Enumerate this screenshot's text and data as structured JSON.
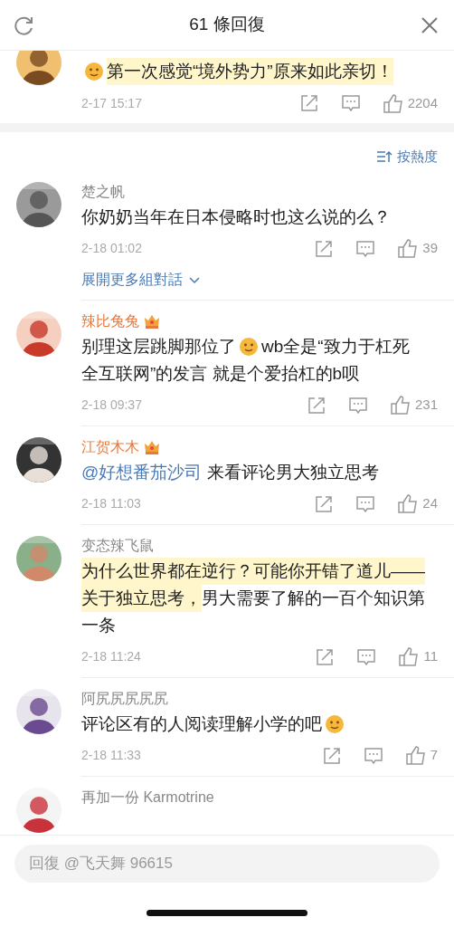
{
  "header": {
    "title": "61 條回復"
  },
  "top_comment": {
    "lines": [
      [
        {
          "kind": "emoji"
        },
        {
          "kind": "text",
          "text": "第一次感觉“境外势力”原来如此亲切！",
          "highlighted": true
        }
      ]
    ],
    "time": "2-17 15:17",
    "likes": "2204"
  },
  "sort": {
    "label": "按熱度"
  },
  "comments": [
    {
      "name": "楚之帆",
      "vip": false,
      "lines": [
        [
          {
            "kind": "text",
            "text": "你奶奶当年在日本侵略时也这么说的么？",
            "highlighted": false
          }
        ]
      ],
      "time": "2-18 01:02",
      "likes": "39",
      "expand": "展開更多組對話"
    },
    {
      "name": "辣比兔兔",
      "vip": true,
      "lines": [
        [
          {
            "kind": "text",
            "text": "别理这层跳脚那位了",
            "highlighted": false
          },
          {
            "kind": "emoji"
          },
          {
            "kind": "text",
            "text": "wb全是“致力于杠死",
            "highlighted": false
          }
        ],
        [
          {
            "kind": "text",
            "text": "全互联网”的发言 就是个爱抬杠的b呗",
            "highlighted": false
          }
        ]
      ],
      "time": "2-18 09:37",
      "likes": "231"
    },
    {
      "name": "江贺木木",
      "vip": true,
      "lines": [
        [
          {
            "kind": "mention",
            "text": "@好想番茄沙司"
          },
          {
            "kind": "text",
            "text": " 来看评论男大独立思考",
            "highlighted": false
          }
        ]
      ],
      "time": "2-18 11:03",
      "likes": "24"
    },
    {
      "name": "变态辣飞鼠",
      "vip": false,
      "lines": [
        [
          {
            "kind": "text",
            "text": "为什么世界都在逆行？可能你开错了道儿——",
            "highlighted": true
          }
        ],
        [
          {
            "kind": "text",
            "text": "关于独立思考，",
            "highlighted": true
          },
          {
            "kind": "text",
            "text": "男大需要了解的一百个知识第",
            "highlighted": false
          }
        ],
        [
          {
            "kind": "text",
            "text": "一条",
            "highlighted": false
          }
        ]
      ],
      "time": "2-18 11:24",
      "likes": "11"
    },
    {
      "name": "阿尻尻尻尻尻",
      "vip": false,
      "lines": [
        [
          {
            "kind": "text",
            "text": "评论区有的人阅读理解小学的吧",
            "highlighted": false
          },
          {
            "kind": "emoji"
          }
        ]
      ],
      "time": "2-18 11:33",
      "likes": "7"
    },
    {
      "name": "再加一份 Karmotrine",
      "vip": false
    }
  ],
  "reply_field": {
    "placeholder": "回復 @飞天舞 96615"
  }
}
